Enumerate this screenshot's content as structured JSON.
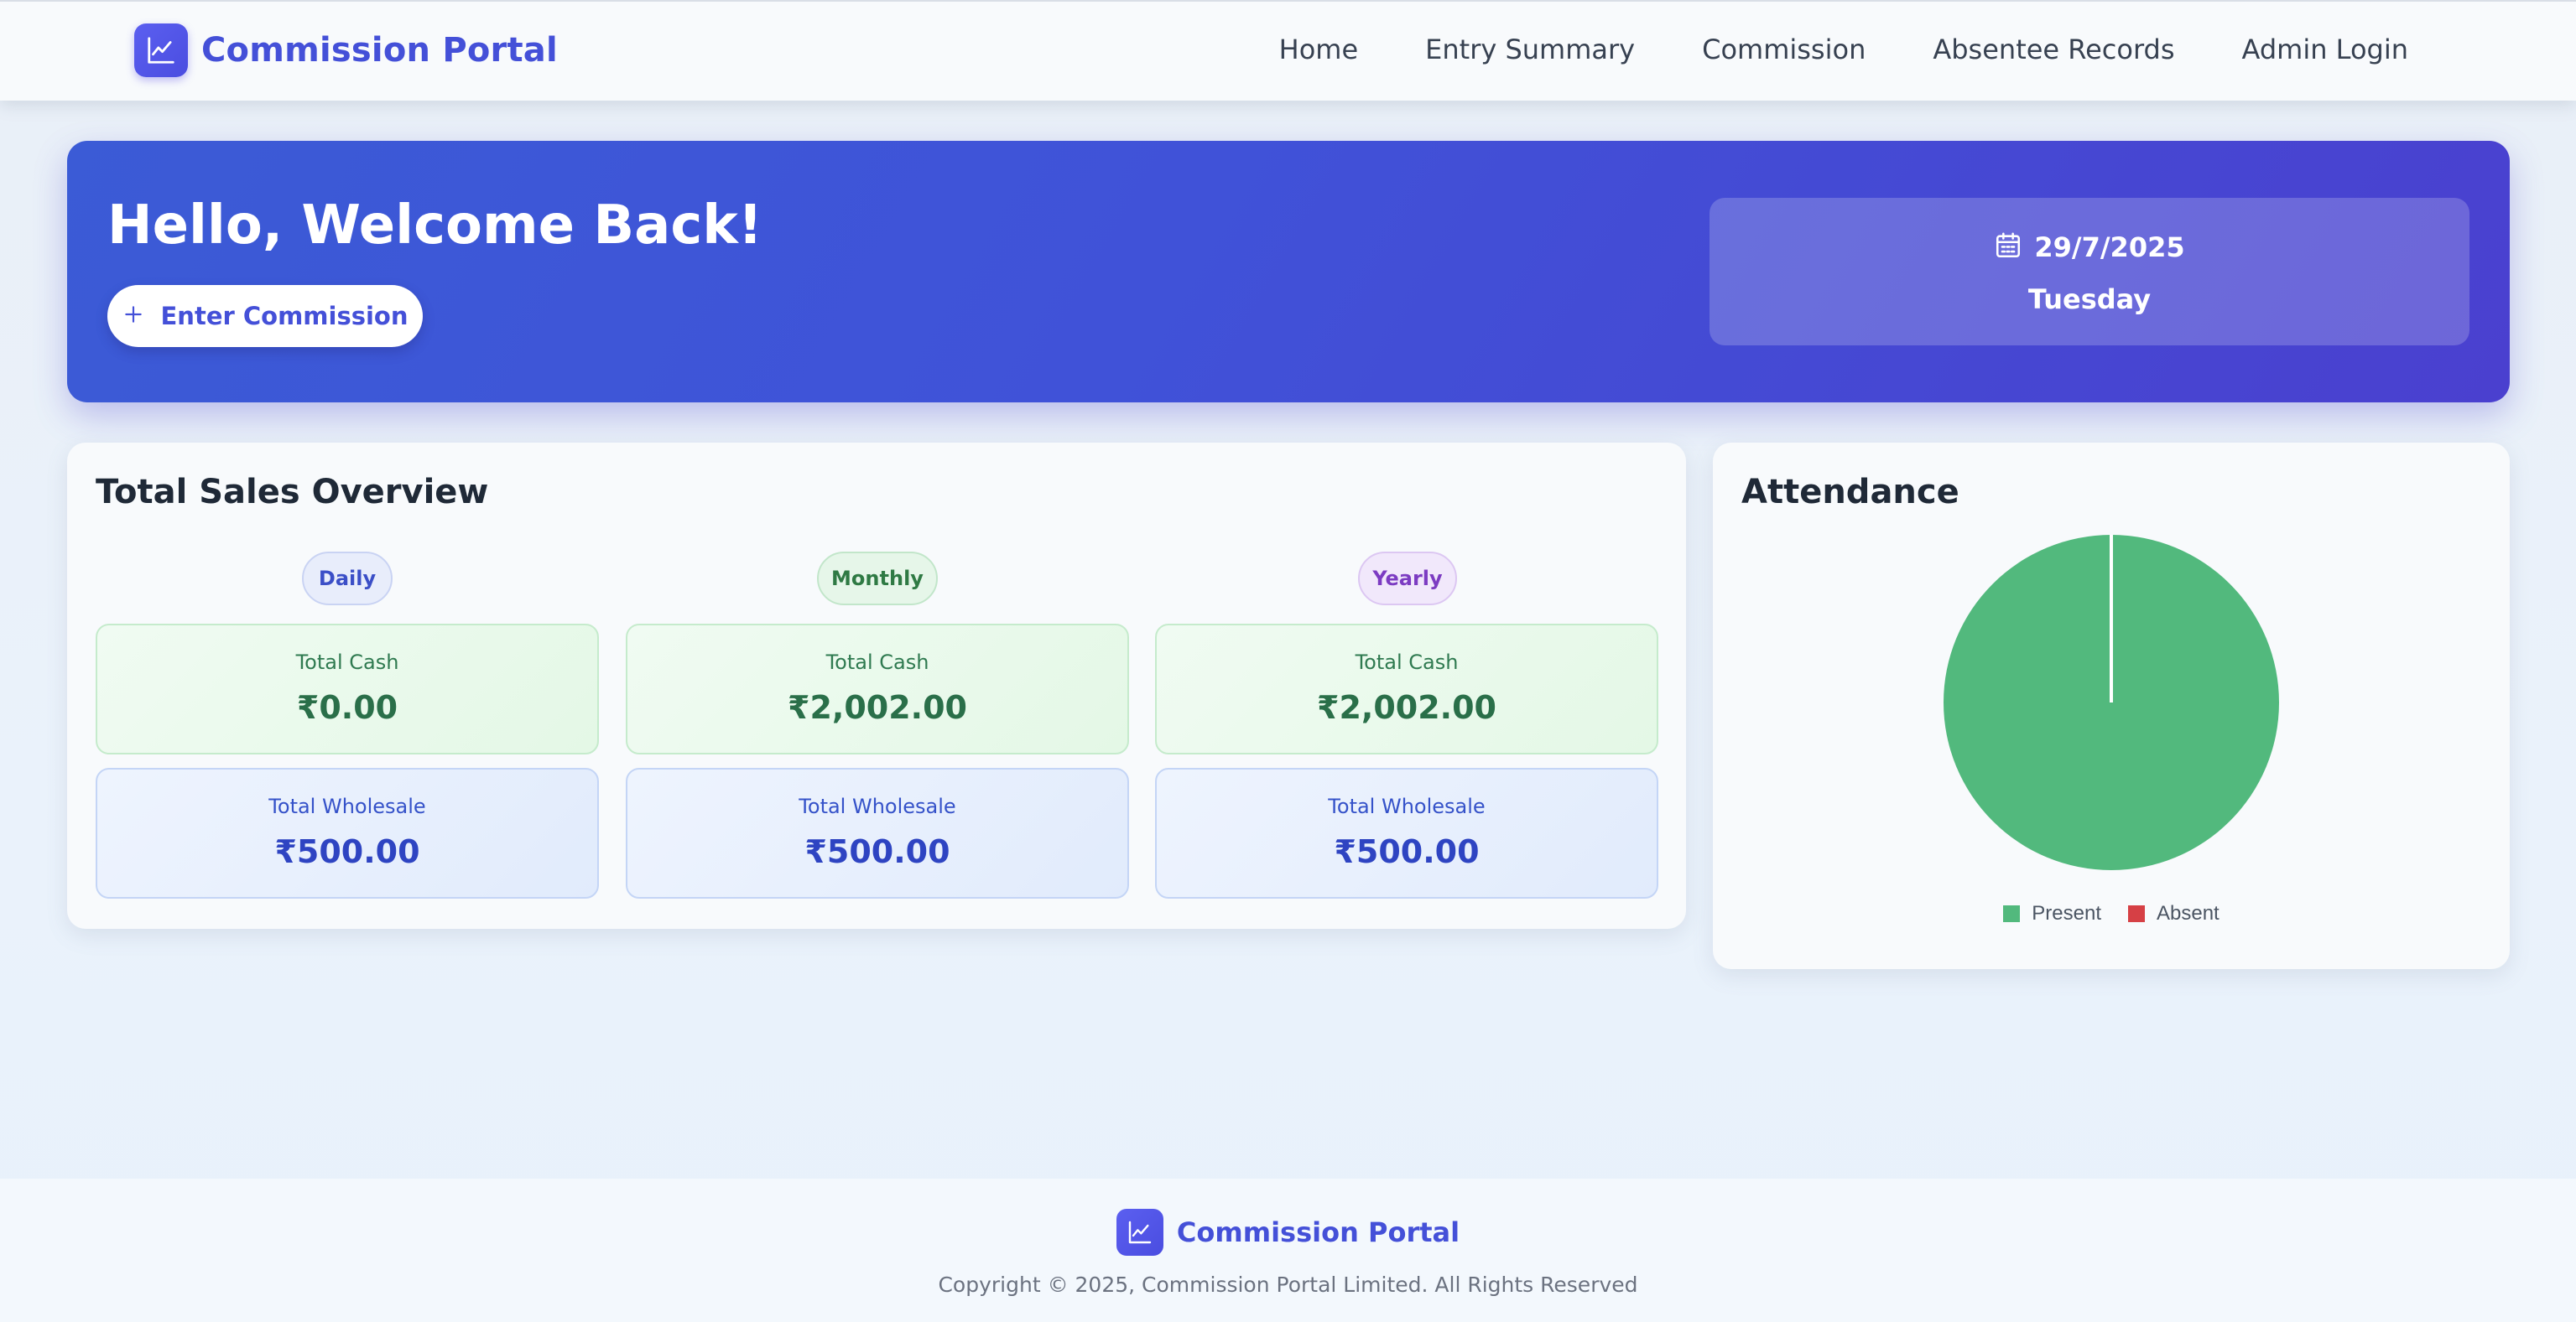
{
  "app": {
    "brand_name": "Commission Portal",
    "brand_icon": "chart-line-icon"
  },
  "nav": {
    "items": [
      {
        "label": "Home"
      },
      {
        "label": "Entry Summary"
      },
      {
        "label": "Commission"
      },
      {
        "label": "Absentee Records"
      },
      {
        "label": "Admin Login"
      }
    ]
  },
  "hero": {
    "greeting": "Hello, Welcome Back!",
    "button_label": "Enter Commission",
    "button_icon": "plus-icon",
    "date": "29/7/2025",
    "date_icon": "calendar-icon",
    "day": "Tuesday"
  },
  "sales": {
    "title": "Total Sales Overview",
    "periods": [
      {
        "label": "Daily",
        "cash_label": "Total Cash",
        "cash_value": "₹0.00",
        "wholesale_label": "Total Wholesale",
        "wholesale_value": "₹500.00"
      },
      {
        "label": "Monthly",
        "cash_label": "Total Cash",
        "cash_value": "₹2,002.00",
        "wholesale_label": "Total Wholesale",
        "wholesale_value": "₹500.00"
      },
      {
        "label": "Yearly",
        "cash_label": "Total Cash",
        "cash_value": "₹2,002.00",
        "wholesale_label": "Total Wholesale",
        "wholesale_value": "₹500.00"
      }
    ]
  },
  "attendance": {
    "title": "Attendance"
  },
  "chart_data": {
    "type": "pie",
    "categories": [
      "Present",
      "Absent"
    ],
    "values": [
      100,
      0
    ],
    "colors": [
      "#52b97d",
      "#d64045"
    ],
    "legend": "bottom"
  },
  "colors": {
    "brand": "#4450d8",
    "hero_gradient_start": "#3b5bd6",
    "hero_gradient_end": "#4a40cf"
  },
  "footer": {
    "brand_name": "Commission Portal",
    "copyright": "Copyright © 2025, Commission Portal Limited. All Rights Reserved"
  }
}
